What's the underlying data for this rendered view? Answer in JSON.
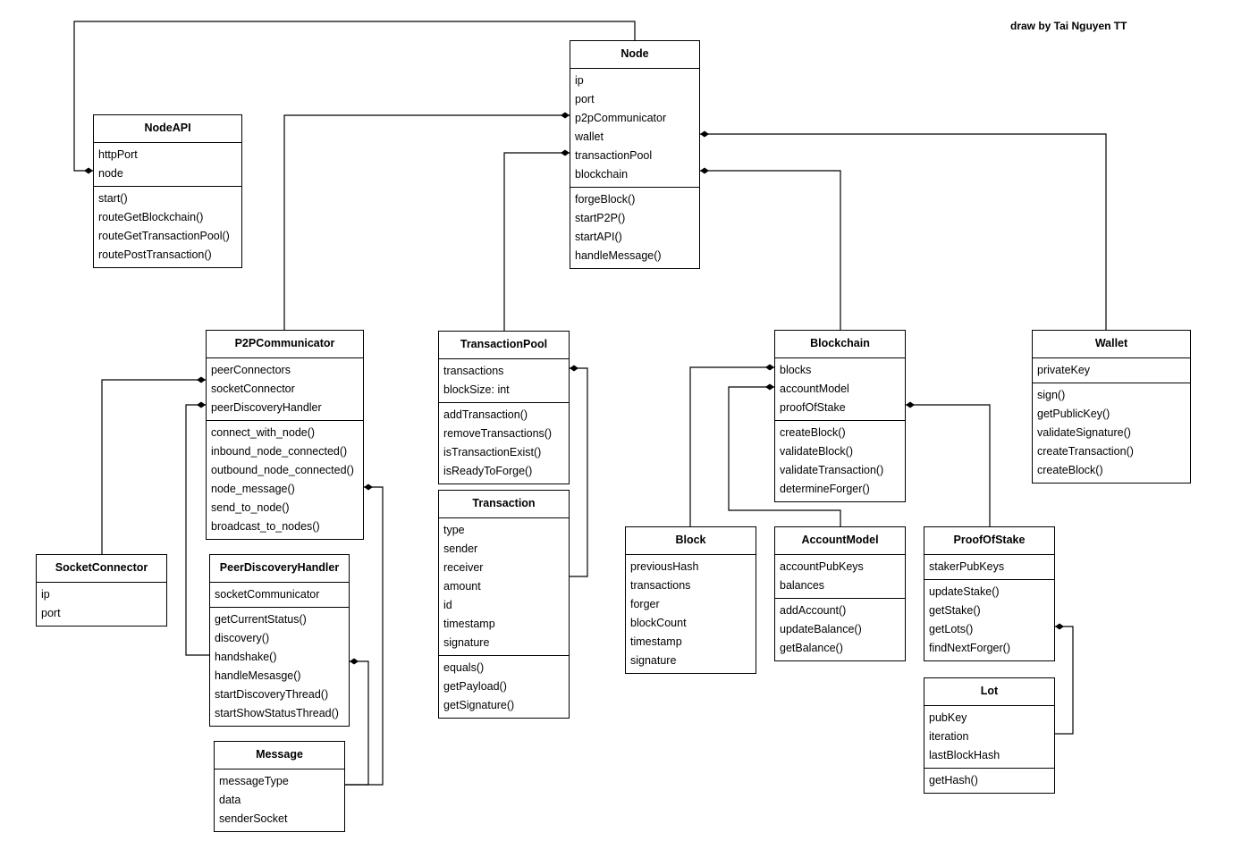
{
  "credit": "draw by Tai Nguyen TT",
  "classes": [
    {
      "id": "NodeAPI",
      "name": "NodeAPI",
      "attributes": [
        "httpPort",
        "node"
      ],
      "methods": [
        "start()",
        "routeGetBlockchain()",
        "routeGetTransactionPool()",
        "routePostTransaction()"
      ]
    },
    {
      "id": "Node",
      "name": "Node",
      "attributes": [
        "ip",
        "port",
        "p2pCommunicator",
        "wallet",
        "transactionPool",
        "blockchain"
      ],
      "methods": [
        "forgeBlock()",
        "startP2P()",
        "startAPI()",
        "handleMessage()"
      ]
    },
    {
      "id": "P2PCommunicator",
      "name": "P2PCommunicator",
      "attributes": [
        "peerConnectors",
        "socketConnector",
        "peerDiscoveryHandler"
      ],
      "methods": [
        "connect_with_node()",
        "inbound_node_connected()",
        "outbound_node_connected()",
        "node_message()",
        "send_to_node()",
        "broadcast_to_nodes()"
      ]
    },
    {
      "id": "TransactionPool",
      "name": "TransactionPool",
      "attributes": [
        "transactions",
        "blockSize: int"
      ],
      "methods": [
        "addTransaction()",
        "removeTransactions()",
        "isTransactionExist()",
        "isReadyToForge()"
      ]
    },
    {
      "id": "Transaction",
      "name": "Transaction",
      "attributes": [
        "type",
        "sender",
        "receiver",
        "amount",
        "id",
        "timestamp",
        "signature"
      ],
      "methods": [
        "equals()",
        "getPayload()",
        "getSignature()"
      ]
    },
    {
      "id": "Blockchain",
      "name": "Blockchain",
      "attributes": [
        "blocks",
        "accountModel",
        "proofOfStake"
      ],
      "methods": [
        "createBlock()",
        "validateBlock()",
        "validateTransaction()",
        "determineForger()"
      ]
    },
    {
      "id": "Wallet",
      "name": "Wallet",
      "attributes": [
        "privateKey"
      ],
      "methods": [
        "sign()",
        "getPublicKey()",
        "validateSignature()",
        "createTransaction()",
        "createBlock()"
      ]
    },
    {
      "id": "SocketConnector",
      "name": "SocketConnector",
      "attributes": [
        "ip",
        "port"
      ],
      "methods": []
    },
    {
      "id": "PeerDiscoveryHandler",
      "name": "PeerDiscoveryHandler",
      "attributes": [
        "socketCommunicator"
      ],
      "methods": [
        "getCurrentStatus()",
        "discovery()",
        "handshake()",
        "handleMesasge()",
        "startDiscoveryThread()",
        "startShowStatusThread()"
      ]
    },
    {
      "id": "Message",
      "name": "Message",
      "attributes": [
        "messageType",
        "data",
        "senderSocket"
      ],
      "methods": []
    },
    {
      "id": "Block",
      "name": "Block",
      "attributes": [
        "previousHash",
        "transactions",
        "forger",
        "blockCount",
        "timestamp",
        "signature"
      ],
      "methods": []
    },
    {
      "id": "AccountModel",
      "name": "AccountModel",
      "attributes": [
        "accountPubKeys",
        "balances"
      ],
      "methods": [
        "addAccount()",
        "updateBalance()",
        "getBalance()"
      ]
    },
    {
      "id": "ProofOfStake",
      "name": "ProofOfStake",
      "attributes": [
        "stakerPubKeys"
      ],
      "methods": [
        "updateStake()",
        "getStake()",
        "getLots()",
        "findNextForger()"
      ]
    },
    {
      "id": "Lot",
      "name": "Lot",
      "attributes": [
        "pubKey",
        "iteration",
        "lastBlockHash"
      ],
      "methods": [
        "getHash()"
      ]
    }
  ],
  "relations": [
    {
      "type": "composition",
      "whole": "NodeAPI",
      "part": "Node"
    },
    {
      "type": "composition",
      "whole": "Node",
      "part": "P2PCommunicator"
    },
    {
      "type": "composition",
      "whole": "Node",
      "part": "TransactionPool"
    },
    {
      "type": "composition",
      "whole": "Node",
      "part": "Blockchain"
    },
    {
      "type": "composition",
      "whole": "Node",
      "part": "Wallet"
    },
    {
      "type": "composition",
      "whole": "P2PCommunicator",
      "part": "SocketConnector"
    },
    {
      "type": "composition",
      "whole": "P2PCommunicator",
      "part": "PeerDiscoveryHandler"
    },
    {
      "type": "composition",
      "whole": "P2PCommunicator",
      "part": "Message"
    },
    {
      "type": "composition",
      "whole": "PeerDiscoveryHandler",
      "part": "Message"
    },
    {
      "type": "composition",
      "whole": "TransactionPool",
      "part": "Transaction"
    },
    {
      "type": "composition",
      "whole": "Blockchain",
      "part": "Block"
    },
    {
      "type": "composition",
      "whole": "Blockchain",
      "part": "AccountModel"
    },
    {
      "type": "composition",
      "whole": "Blockchain",
      "part": "ProofOfStake"
    },
    {
      "type": "composition",
      "whole": "ProofOfStake",
      "part": "Lot"
    }
  ]
}
